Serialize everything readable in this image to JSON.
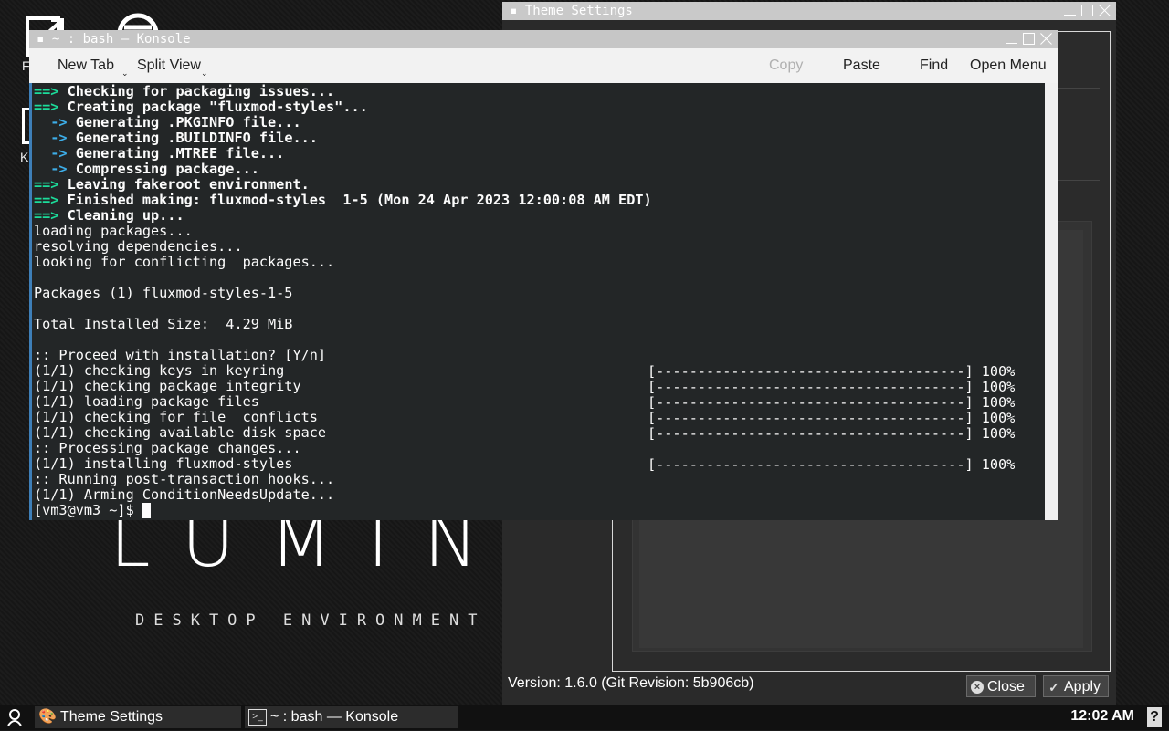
{
  "desktop": {
    "icon_labels": [
      "F",
      "K"
    ],
    "logo": "LUMINA",
    "logo_sub": "DESKTOP ENVIRONMENT"
  },
  "theme_window": {
    "title": "Theme Settings",
    "version": "Version: 1.6.0 (Git Revision: 5b906cb)",
    "close_label": "Close",
    "apply_label": "Apply"
  },
  "konsole": {
    "title": "~ : bash — Konsole",
    "toolbar": {
      "new_tab": "New Tab",
      "split_view": "Split View",
      "copy": "Copy",
      "paste": "Paste",
      "find": "Find",
      "open_menu": "Open Menu"
    },
    "lines": [
      {
        "p": "==>",
        "t": " Checking for packaging issues...",
        "s": "g"
      },
      {
        "p": "==>",
        "t": " Creating package \"fluxmod-styles\"...",
        "s": "g"
      },
      {
        "p": "  ->",
        "t": " Generating .PKGINFO file...",
        "s": "bl"
      },
      {
        "p": "  ->",
        "t": " Generating .BUILDINFO file...",
        "s": "bl"
      },
      {
        "p": "  ->",
        "t": " Generating .MTREE file...",
        "s": "bl"
      },
      {
        "p": "  ->",
        "t": " Compressing package...",
        "s": "bl"
      },
      {
        "p": "==>",
        "t": " Leaving fakeroot environment.",
        "s": "g"
      },
      {
        "p": "==>",
        "t": " Finished making: fluxmod-styles  1-5 (Mon 24 Apr 2023 12:00:08 AM EDT)",
        "s": "g"
      },
      {
        "p": "==>",
        "t": " Cleaning up...",
        "s": "g"
      },
      {
        "p": "",
        "t": "loading packages...",
        "s": ""
      },
      {
        "p": "",
        "t": "resolving dependencies...",
        "s": ""
      },
      {
        "p": "",
        "t": "looking for conflicting  packages...",
        "s": ""
      },
      {
        "p": "",
        "t": "",
        "s": ""
      },
      {
        "p": "",
        "t": "Packages (1) fluxmod-styles-1-5",
        "s": ""
      },
      {
        "p": "",
        "t": "",
        "s": ""
      },
      {
        "p": "",
        "t": "Total Installed Size:  4.29 MiB",
        "s": ""
      },
      {
        "p": "",
        "t": "",
        "s": ""
      },
      {
        "p": "",
        "t": ":: Proceed with installation? [Y/n]",
        "s": ""
      },
      {
        "p": "",
        "t": "(1/1) checking keys in keyring",
        "s": ""
      },
      {
        "p": "",
        "t": "(1/1) checking package integrity",
        "s": ""
      },
      {
        "p": "",
        "t": "(1/1) loading package files",
        "s": ""
      },
      {
        "p": "",
        "t": "(1/1) checking for file  conflicts",
        "s": ""
      },
      {
        "p": "",
        "t": "(1/1) checking available disk space",
        "s": ""
      },
      {
        "p": "",
        "t": ":: Processing package changes...",
        "s": ""
      },
      {
        "p": "",
        "t": "(1/1) installing fluxmod-styles",
        "s": ""
      },
      {
        "p": "",
        "t": ":: Running post-transaction hooks...",
        "s": ""
      },
      {
        "p": "",
        "t": "(1/1) Arming ConditionNeedsUpdate...",
        "s": ""
      },
      {
        "p": "",
        "t": "[vm3@vm3 ~]$ ",
        "s": ""
      }
    ],
    "progress_bar": "[-------------------------------------] 100%"
  },
  "taskbar": {
    "task1": "Theme Settings",
    "task2": "~ : bash — Konsole",
    "clock": "12:02 AM"
  }
}
